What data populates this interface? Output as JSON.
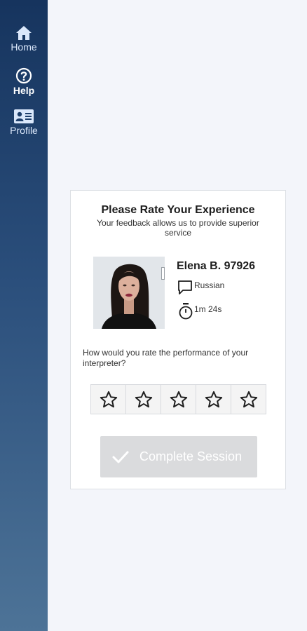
{
  "sidebar": {
    "items": [
      {
        "label": "Home",
        "icon": "home-icon"
      },
      {
        "label": "Help",
        "icon": "help-icon"
      },
      {
        "label": "Profile",
        "icon": "profile-icon"
      }
    ]
  },
  "rating_card": {
    "title": "Please Rate Your Experience",
    "subtitle": "Your feedback allows us to provide superior service",
    "interpreter": {
      "name": "Elena B. 97926",
      "language": "Russian",
      "duration": "1m 24s"
    },
    "question": "How would you rate the performance of your interpreter?",
    "stars": {
      "count": 5,
      "selected": 0
    },
    "complete_button": "Complete Session"
  },
  "colors": {
    "sidebar_top": "#16345e",
    "sidebar_bottom": "#4d7397",
    "background": "#f3f5fa",
    "button_disabled": "#dadbdd"
  }
}
